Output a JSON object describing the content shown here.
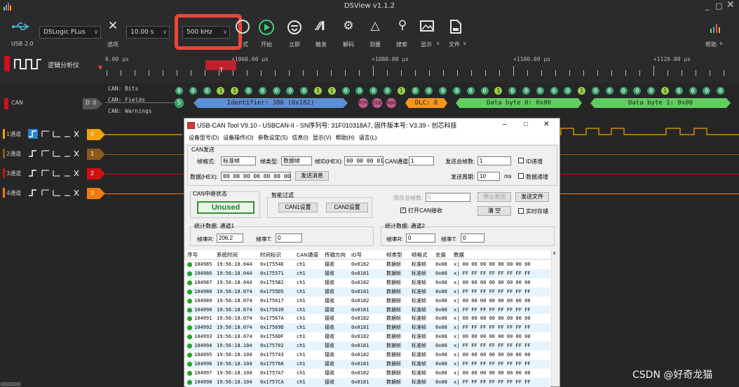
{
  "window": {
    "title": "DSView v1.1.2",
    "min": "_",
    "max": "□",
    "close": "✕"
  },
  "toolbar": {
    "usb_label": "USB 2.0",
    "device": "DSLogic PLus",
    "options_label": "选项",
    "duration": "10.00 s",
    "samplerate": "500 kHz",
    "mode_label": "式",
    "start_label": "开始",
    "instant_label": "立即",
    "trigger_label": "触发",
    "decode_label": "解码",
    "measure_label": "测量",
    "search_label": "搜索",
    "display_label": "显示",
    "file_label": "文件",
    "help_label": "帮助"
  },
  "ruler": {
    "first": "0.00 μs",
    "t1": "+1060.00 μs",
    "t2": "+1080.00 μs",
    "t3": "+1100.00 μs",
    "t4": "+1120.00 μs",
    "cursor": "T"
  },
  "left_panel": {
    "logic_title": "逻辑分析仪",
    "can_label": "CAN",
    "can_ch": "0",
    "can_d": "D"
  },
  "can_rows": {
    "bits": "CAN: Bits",
    "fields": "CAN: Fields",
    "warnings": "CAN: Warnings"
  },
  "bits": [
    "0",
    "0",
    "0",
    "1",
    "1",
    "0",
    "0",
    "0",
    "0",
    "0",
    "1",
    "1",
    "0",
    "0",
    "0",
    "0",
    "1",
    "0",
    "0",
    "0",
    "0",
    "0",
    "0",
    "1",
    "0",
    "0",
    "0",
    "0",
    "0",
    "1",
    "0",
    "0",
    "0",
    "0",
    "0",
    "1",
    "0",
    "0",
    "0",
    "0"
  ],
  "fields": {
    "s": "S",
    "identifier": "Identifier: 386 (0x182)",
    "rtr": "RTR",
    "ide": "IDE",
    "rb0": "RB0",
    "dlc": "DLC: 8",
    "db0": "Data byte 0: 0x00",
    "db1": "Data byte 1: 0x00"
  },
  "channels": [
    {
      "label": "1通道",
      "num": "0",
      "color": "#f2a100"
    },
    {
      "label": "2通道",
      "num": "1",
      "color": "#8a5a1a"
    },
    {
      "label": "3通道",
      "num": "2",
      "color": "#d01010"
    },
    {
      "label": "4通道",
      "num": "3",
      "color": "#f07a10"
    }
  ],
  "dialog": {
    "title": "USB-CAN Tool V9.10 - USBCAN-II - SN序列号: 31F010318A7, 固件版本号: V3.39 - 创芯科技",
    "menu": [
      "设备型号(D)",
      "设备操作(O)",
      "参数设定(S)",
      "信息(I)",
      "显示(V)",
      "帮助(H)",
      "语言(L)"
    ],
    "send_group": "CAN发送",
    "frame_format_label": "帧格式:",
    "frame_format": "标准帧",
    "frame_type_label": "帧类型:",
    "frame_type": "数据帧",
    "frame_id_label": "帧ID(HEX):",
    "frame_id": "00 00 00 01",
    "can_channel_label": "CAN通道:",
    "can_channel": "1",
    "send_total_label": "发送总帧数:",
    "send_total": "1",
    "id_inc": "ID递增",
    "data_label": "数据(HEX):",
    "data": "00 00 00 00 00 00 00 00",
    "send_btn": "发送消息",
    "send_period_label": "发送周期:",
    "send_period": "10",
    "ms": "ms",
    "data_inc": "数据递增",
    "relay_group": "CAN中继状态",
    "relay_status": "Unused",
    "filter_group": "智能过滤",
    "can1_btn": "CAN1设置",
    "can2_btn": "CAN2设置",
    "save_total_label": "保存总帧数:",
    "save_total": "0",
    "stop_send": "停止发送",
    "send_file": "发送文件",
    "open_recv": "打开CAN接收",
    "clear_btn": "清 空",
    "realtime_save": "实时存储",
    "stats1": "统计数据: 通道1",
    "rate1_label": "帧率R:",
    "rate1": "206.2",
    "rate1t_label": "帧率T:",
    "rate1t": "0",
    "stats2": "统计数据: 通道2",
    "rate2_label": "帧率R:",
    "rate2": "0",
    "rate2t_label": "帧率T:",
    "rate2t": "0",
    "headers": [
      "序号",
      "系统时间",
      "时间标识",
      "CAN通道",
      "传输方向",
      "ID号",
      "帧类型",
      "帧格式",
      "长度",
      "数据"
    ],
    "rows": [
      [
        "104985",
        "19:56:18.044",
        "0x17554E",
        "ch1",
        "接收",
        "0x0182",
        "数据帧",
        "标准帧",
        "0x08",
        "x| 00 00 00 00 00 00 00 00"
      ],
      [
        "104986",
        "19:56:18.044",
        "0x175571",
        "ch1",
        "接收",
        "0x0181",
        "数据帧",
        "标准帧",
        "0x08",
        "x| FF FF FF FF FF FF FF FF"
      ],
      [
        "104987",
        "19:56:18.044",
        "0x1755B2",
        "ch1",
        "接收",
        "0x0182",
        "数据帧",
        "标准帧",
        "0x08",
        "x| 00 00 00 00 00 00 00 00"
      ],
      [
        "104988",
        "19:56:18.074",
        "0x1755D5",
        "ch1",
        "接收",
        "0x0181",
        "数据帧",
        "标准帧",
        "0x08",
        "x| FF FF FF FF FF FF FF FF"
      ],
      [
        "104989",
        "19:56:18.074",
        "0x175617",
        "ch1",
        "接收",
        "0x0182",
        "数据帧",
        "标准帧",
        "0x08",
        "x| 00 00 00 00 00 00 00 00"
      ],
      [
        "104990",
        "19:56:18.074",
        "0x175639",
        "ch1",
        "接收",
        "0x0181",
        "数据帧",
        "标准帧",
        "0x08",
        "x| FF FF FF FF FF FF FF FF"
      ],
      [
        "104991",
        "19:56:18.074",
        "0x17567A",
        "ch1",
        "接收",
        "0x0182",
        "数据帧",
        "标准帧",
        "0x08",
        "x| 00 00 00 00 00 00 00 00"
      ],
      [
        "104992",
        "19:56:18.074",
        "0x17569D",
        "ch1",
        "接收",
        "0x0181",
        "数据帧",
        "标准帧",
        "0x08",
        "x| FF FF FF FF FF FF FF FF"
      ],
      [
        "104993",
        "19:56:18.074",
        "0x1756DF",
        "ch1",
        "接收",
        "0x0182",
        "数据帧",
        "标准帧",
        "0x08",
        "x| 00 00 00 00 00 00 00 00"
      ],
      [
        "104994",
        "19:56:18.104",
        "0x175702",
        "ch1",
        "接收",
        "0x0181",
        "数据帧",
        "标准帧",
        "0x08",
        "x| FF FF FF FF FF FF FF FF"
      ],
      [
        "104995",
        "19:56:18.104",
        "0x175743",
        "ch1",
        "接收",
        "0x0182",
        "数据帧",
        "标准帧",
        "0x08",
        "x| 00 00 00 00 00 00 00 00"
      ],
      [
        "104996",
        "19:56:18.104",
        "0x175766",
        "ch1",
        "接收",
        "0x0181",
        "数据帧",
        "标准帧",
        "0x08",
        "x| FF FF FF FF FF FF FF FF"
      ],
      [
        "104997",
        "19:56:18.104",
        "0x1757A7",
        "ch1",
        "接收",
        "0x0182",
        "数据帧",
        "标准帧",
        "0x08",
        "x| 00 00 00 00 00 00 00 00"
      ],
      [
        "104998",
        "19:56:18.104",
        "0x1757CA",
        "ch1",
        "接收",
        "0x0181",
        "数据帧",
        "标准帧",
        "0x08",
        "x| FF FF FF FF FF FF FF FF"
      ]
    ]
  },
  "watermark": "CSDN @好奇龙猫",
  "colors": {
    "highlight": "#e8473f",
    "accent_green": "#3b9e6a",
    "field_blue": "#5b8fd6",
    "field_green": "#5ecf5e",
    "dlc_orange": "#f7961a",
    "rtr_pink": "#c45a8a"
  }
}
